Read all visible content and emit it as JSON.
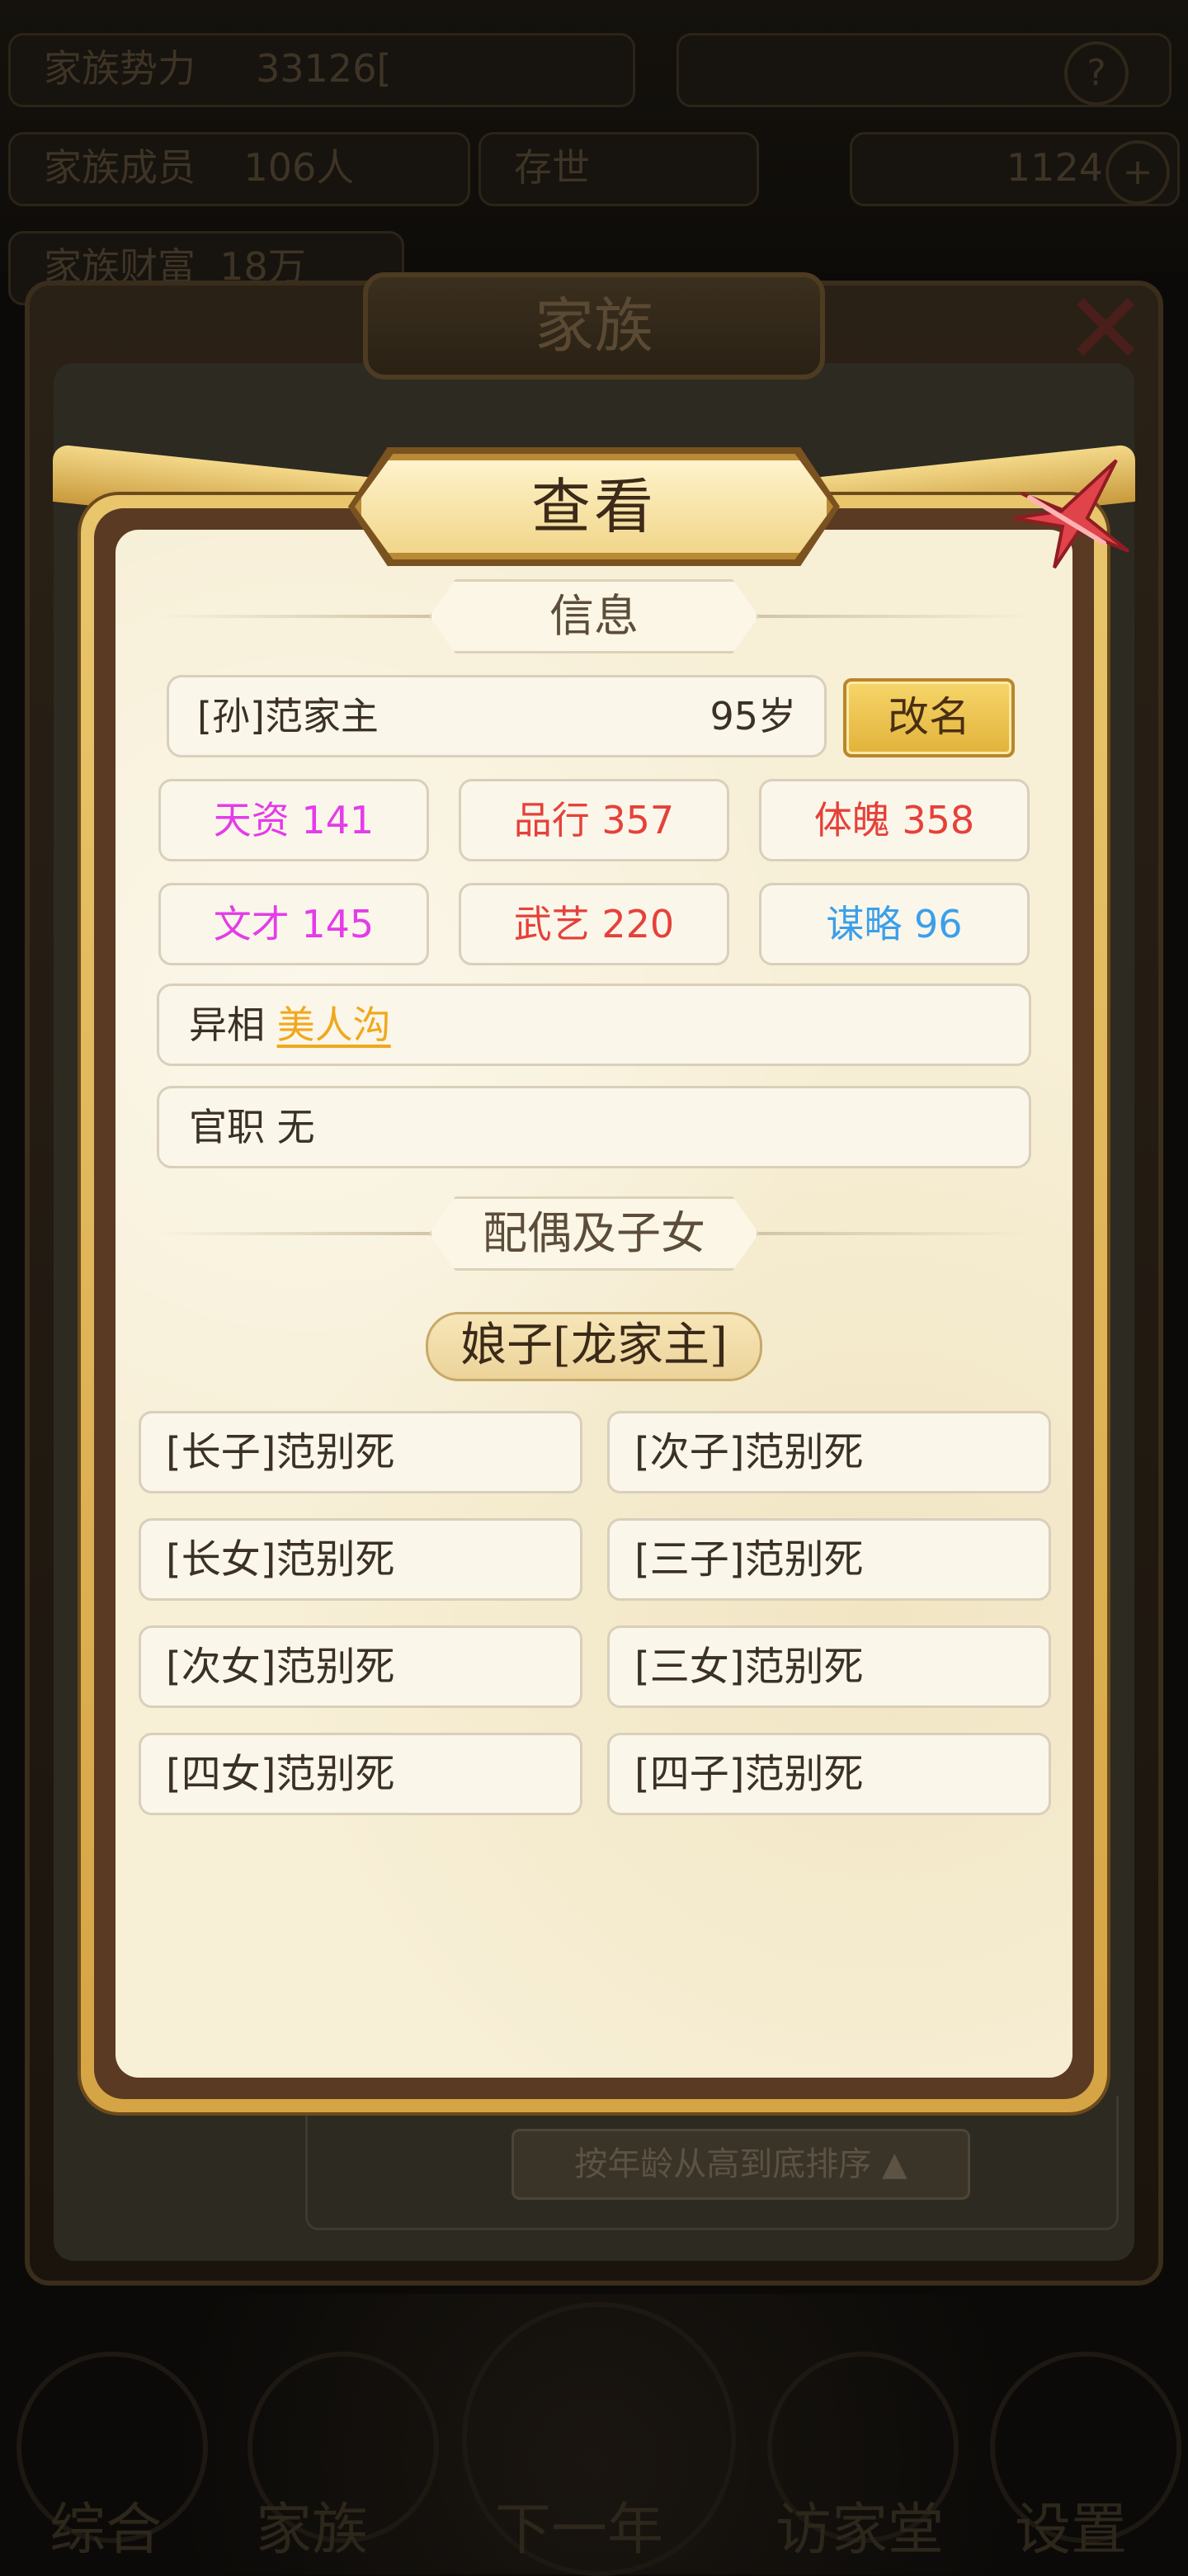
{
  "background": {
    "top_rows": [
      "家族势力",
      "33126[",
      "家族成员",
      "106人",
      "存世",
      "1124",
      "家族财富",
      "18万"
    ],
    "family_title": "家族",
    "sort_label": "按年龄从高到底排序",
    "nav_labels": [
      "综合",
      "家族",
      "下一年",
      "访家堂",
      "设置"
    ]
  },
  "dialog": {
    "title": "查看",
    "info_section": "信息",
    "person": {
      "name": "[孙]范家主",
      "age": "95岁",
      "rename_label": "改名"
    },
    "stats": [
      {
        "label": "天资 141",
        "color": "#e43ce8"
      },
      {
        "label": "品行 357",
        "color": "#e5413a"
      },
      {
        "label": "体魄 358",
        "color": "#e5413a"
      },
      {
        "label": "文才 145",
        "color": "#e43ce8"
      },
      {
        "label": "武艺 220",
        "color": "#e5413a"
      },
      {
        "label": "谋略 96",
        "color": "#3b9fea"
      }
    ],
    "trait": {
      "label": "异相",
      "value": "美人沟",
      "value_color": "#f0a81c"
    },
    "office": {
      "label": "官职",
      "value": "无"
    },
    "family_section": "配偶及子女",
    "spouse": "娘子[龙家主]",
    "children": [
      "[长子]范别死",
      "[次子]范别死",
      "[长女]范别死",
      "[三子]范别死",
      "[次女]范别死",
      "[三女]范别死",
      "[四女]范别死",
      "[四子]范别死"
    ]
  }
}
